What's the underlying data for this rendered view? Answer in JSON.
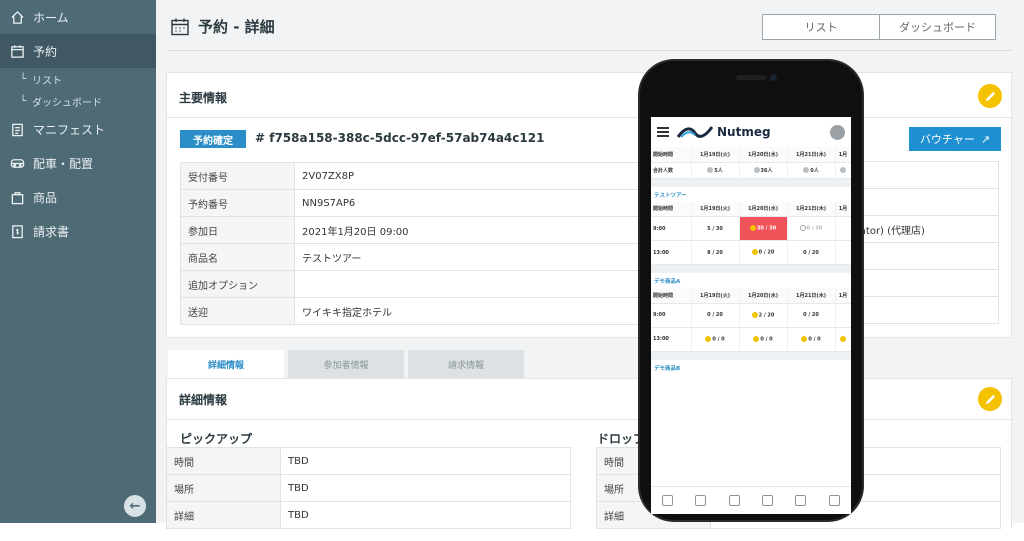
{
  "sidebar": {
    "items": [
      {
        "label": "ホーム",
        "icon": "home-icon"
      },
      {
        "label": "予約",
        "icon": "calendar-icon"
      },
      {
        "label": "マニフェスト",
        "icon": "clipboard-icon"
      },
      {
        "label": "配車・配置",
        "icon": "bus-icon"
      },
      {
        "label": "商品",
        "icon": "bag-icon"
      },
      {
        "label": "請求書",
        "icon": "invoice-icon"
      }
    ],
    "sub_items": [
      "リスト",
      "ダッシュボード"
    ],
    "sub_prefix": "└"
  },
  "header": {
    "title": "予約 - 詳細",
    "tabs": [
      "リスト",
      "ダッシュボード"
    ]
  },
  "main_info": {
    "title": "主要情報",
    "status": "予約確定",
    "reservation_id": "# f758a158-388c-5dcc-97ef-57ab74a4c121",
    "voucher_label": "バウチャー",
    "rows": [
      {
        "key": "受付番号",
        "value": "2V07ZX8P"
      },
      {
        "key": "予約番号",
        "value": "NN9S7AP6"
      },
      {
        "key": "参加日",
        "value": "2021年1月20日 09:00"
      },
      {
        "key": "商品名",
        "value": "テストツアー"
      },
      {
        "key": "追加オプション",
        "value": ""
      },
      {
        "key": "送迎",
        "value": "ワイキキ指定ホテル"
      }
    ],
    "right_partial": "iator) (代理店)"
  },
  "detail_tabs": [
    "詳細情報",
    "参加者情報",
    "請求情報"
  ],
  "detail": {
    "title": "詳細情報",
    "pickup": {
      "title": "ピックアップ",
      "rows": [
        {
          "key": "時間",
          "value": "TBD"
        },
        {
          "key": "場所",
          "value": "TBD"
        },
        {
          "key": "詳細",
          "value": "TBD"
        }
      ]
    },
    "dropoff": {
      "title": "ドロップ",
      "rows": [
        {
          "key": "時間",
          "value": ""
        },
        {
          "key": "場所",
          "value": ""
        },
        {
          "key": "詳細",
          "value": ""
        }
      ]
    }
  },
  "phone": {
    "app_name": "Nutmeg",
    "summary": {
      "header": [
        "開始時間",
        "1月19日(火)",
        "1月20日(水)",
        "1月21日(木)",
        "1月"
      ],
      "row_label": "合計人数",
      "values": [
        "5人",
        "36人",
        "0人",
        ""
      ]
    },
    "sections": [
      {
        "title": "テストツアー",
        "header": [
          "開始時間",
          "1月19日(火)",
          "1月20日(水)",
          "1月21日(木)",
          "1月"
        ],
        "rows": [
          {
            "time": "9:00",
            "cells": [
              "5 / 30",
              "30 / 30",
              "0 / 30",
              ""
            ]
          },
          {
            "time": "13:00",
            "cells": [
              "8 / 20",
              "0 / 20",
              "0 / 20",
              ""
            ]
          }
        ]
      },
      {
        "title": "デモ商品A",
        "header": [
          "開始時間",
          "1月19日(火)",
          "1月20日(水)",
          "1月21日(木)",
          "1月"
        ],
        "rows": [
          {
            "time": "9:00",
            "cells": [
              "0 / 20",
              "2 / 20",
              "0 / 20",
              ""
            ]
          },
          {
            "time": "13:00",
            "cells": [
              "0 / 0",
              "0 / 0",
              "0 / 0",
              ""
            ]
          }
        ]
      }
    ],
    "section3_title": "デモ商品B",
    "colors": {
      "full": "#f0545a",
      "accent": "#2b8ec8",
      "warn": "#f5c200"
    }
  }
}
